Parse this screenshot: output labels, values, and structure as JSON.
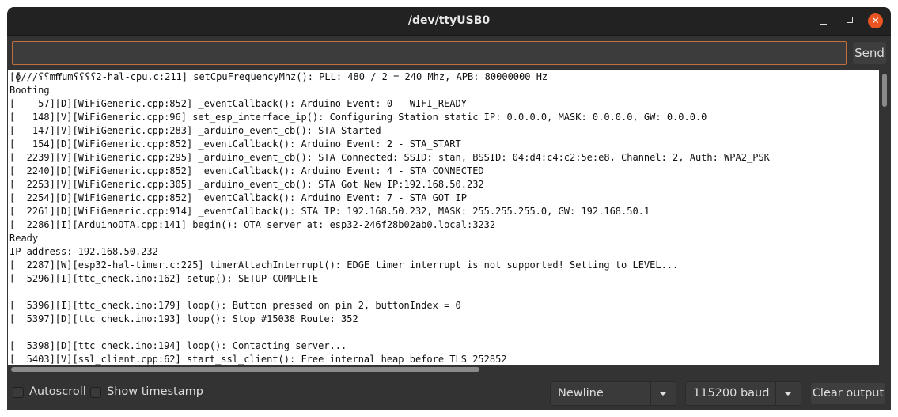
{
  "window": {
    "title": "/dev/ttyUSB0",
    "controls": {
      "minimize": "minimize",
      "maximize": "maximize",
      "close": "✕"
    }
  },
  "input": {
    "value": "",
    "placeholder": "",
    "send_label": "Send"
  },
  "output": {
    "lines": [
      "[ɸ///ʕʕmﬀumʕʕʕʕ2-hal-cpu.c:211] setCpuFrequencyMhz(): PLL: 480 / 2 = 240 Mhz, APB: 80000000 Hz",
      "Booting",
      "[    57][D][WiFiGeneric.cpp:852] _eventCallback(): Arduino Event: 0 - WIFI_READY",
      "[   148][V][WiFiGeneric.cpp:96] set_esp_interface_ip(): Configuring Station static IP: 0.0.0.0, MASK: 0.0.0.0, GW: 0.0.0.0",
      "[   147][V][WiFiGeneric.cpp:283] _arduino_event_cb(): STA Started",
      "[   154][D][WiFiGeneric.cpp:852] _eventCallback(): Arduino Event: 2 - STA_START",
      "[  2239][V][WiFiGeneric.cpp:295] _arduino_event_cb(): STA Connected: SSID: stan, BSSID: 04:d4:c4:c2:5e:e8, Channel: 2, Auth: WPA2_PSK",
      "[  2240][D][WiFiGeneric.cpp:852] _eventCallback(): Arduino Event: 4 - STA_CONNECTED",
      "[  2253][V][WiFiGeneric.cpp:305] _arduino_event_cb(): STA Got New IP:192.168.50.232",
      "[  2254][D][WiFiGeneric.cpp:852] _eventCallback(): Arduino Event: 7 - STA_GOT_IP",
      "[  2261][D][WiFiGeneric.cpp:914] _eventCallback(): STA IP: 192.168.50.232, MASK: 255.255.255.0, GW: 192.168.50.1",
      "[  2286][I][ArduinoOTA.cpp:141] begin(): OTA server at: esp32-246f28b02ab0.local:3232",
      "Ready",
      "IP address: 192.168.50.232",
      "[  2287][W][esp32-hal-timer.c:225] timerAttachInterrupt(): EDGE timer interrupt is not supported! Setting to LEVEL...",
      "[  5296][I][ttc_check.ino:162] setup(): SETUP COMPLETE",
      "",
      "[  5396][I][ttc_check.ino:179] loop(): Button pressed on pin 2, buttonIndex = 0",
      "[  5397][D][ttc_check.ino:193] loop(): Stop #15038 Route: 352",
      "",
      "[  5398][D][ttc_check.ino:194] loop(): Contacting server...",
      "[  5403][V][ssl_client.cpp:62] start_ssl_client(): Free internal heap before TLS 252852"
    ]
  },
  "footer": {
    "autoscroll": {
      "label": "Autoscroll",
      "checked": false
    },
    "show_timestamp": {
      "label": "Show timestamp",
      "checked": false
    },
    "line_ending": {
      "selected": "Newline"
    },
    "baud_rate": {
      "selected": "115200 baud"
    },
    "clear_label": "Clear output"
  },
  "colors": {
    "accent_border": "#c0703f",
    "close_button": "#e95420"
  }
}
